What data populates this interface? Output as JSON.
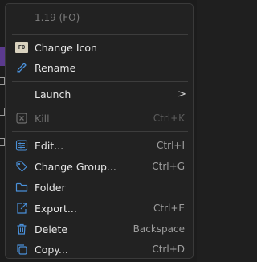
{
  "menu": {
    "header": "1.19 (FO)",
    "items": [
      {
        "label": "Change Icon",
        "shortcut": "",
        "icon": "fo-badge-icon",
        "badge_text": "FO"
      },
      {
        "label": "Rename",
        "shortcut": "",
        "icon": "pencil-icon"
      },
      {
        "label": "Launch",
        "shortcut": "",
        "icon": "",
        "submenu_indicator": ">"
      },
      {
        "label": "Kill",
        "shortcut": "Ctrl+K",
        "icon": "close-box-icon",
        "disabled": true
      },
      {
        "label": "Edit...",
        "shortcut": "Ctrl+I",
        "icon": "sliders-icon"
      },
      {
        "label": "Change Group...",
        "shortcut": "Ctrl+G",
        "icon": "tag-icon"
      },
      {
        "label": "Folder",
        "shortcut": "",
        "icon": "folder-icon"
      },
      {
        "label": "Export...",
        "shortcut": "Ctrl+E",
        "icon": "export-icon"
      },
      {
        "label": "Delete",
        "shortcut": "Backspace",
        "icon": "trash-icon"
      },
      {
        "label": "Copy...",
        "shortcut": "Ctrl+D",
        "icon": "copy-icon"
      }
    ]
  },
  "colors": {
    "menu_background": "#222222",
    "text": "#e6e6e6",
    "disabled_text": "#6f6f6f",
    "shortcut_text": "#9e9e9e",
    "icon_accent": "#4a90d9",
    "backdrop_accent": "#5b3a8e"
  }
}
